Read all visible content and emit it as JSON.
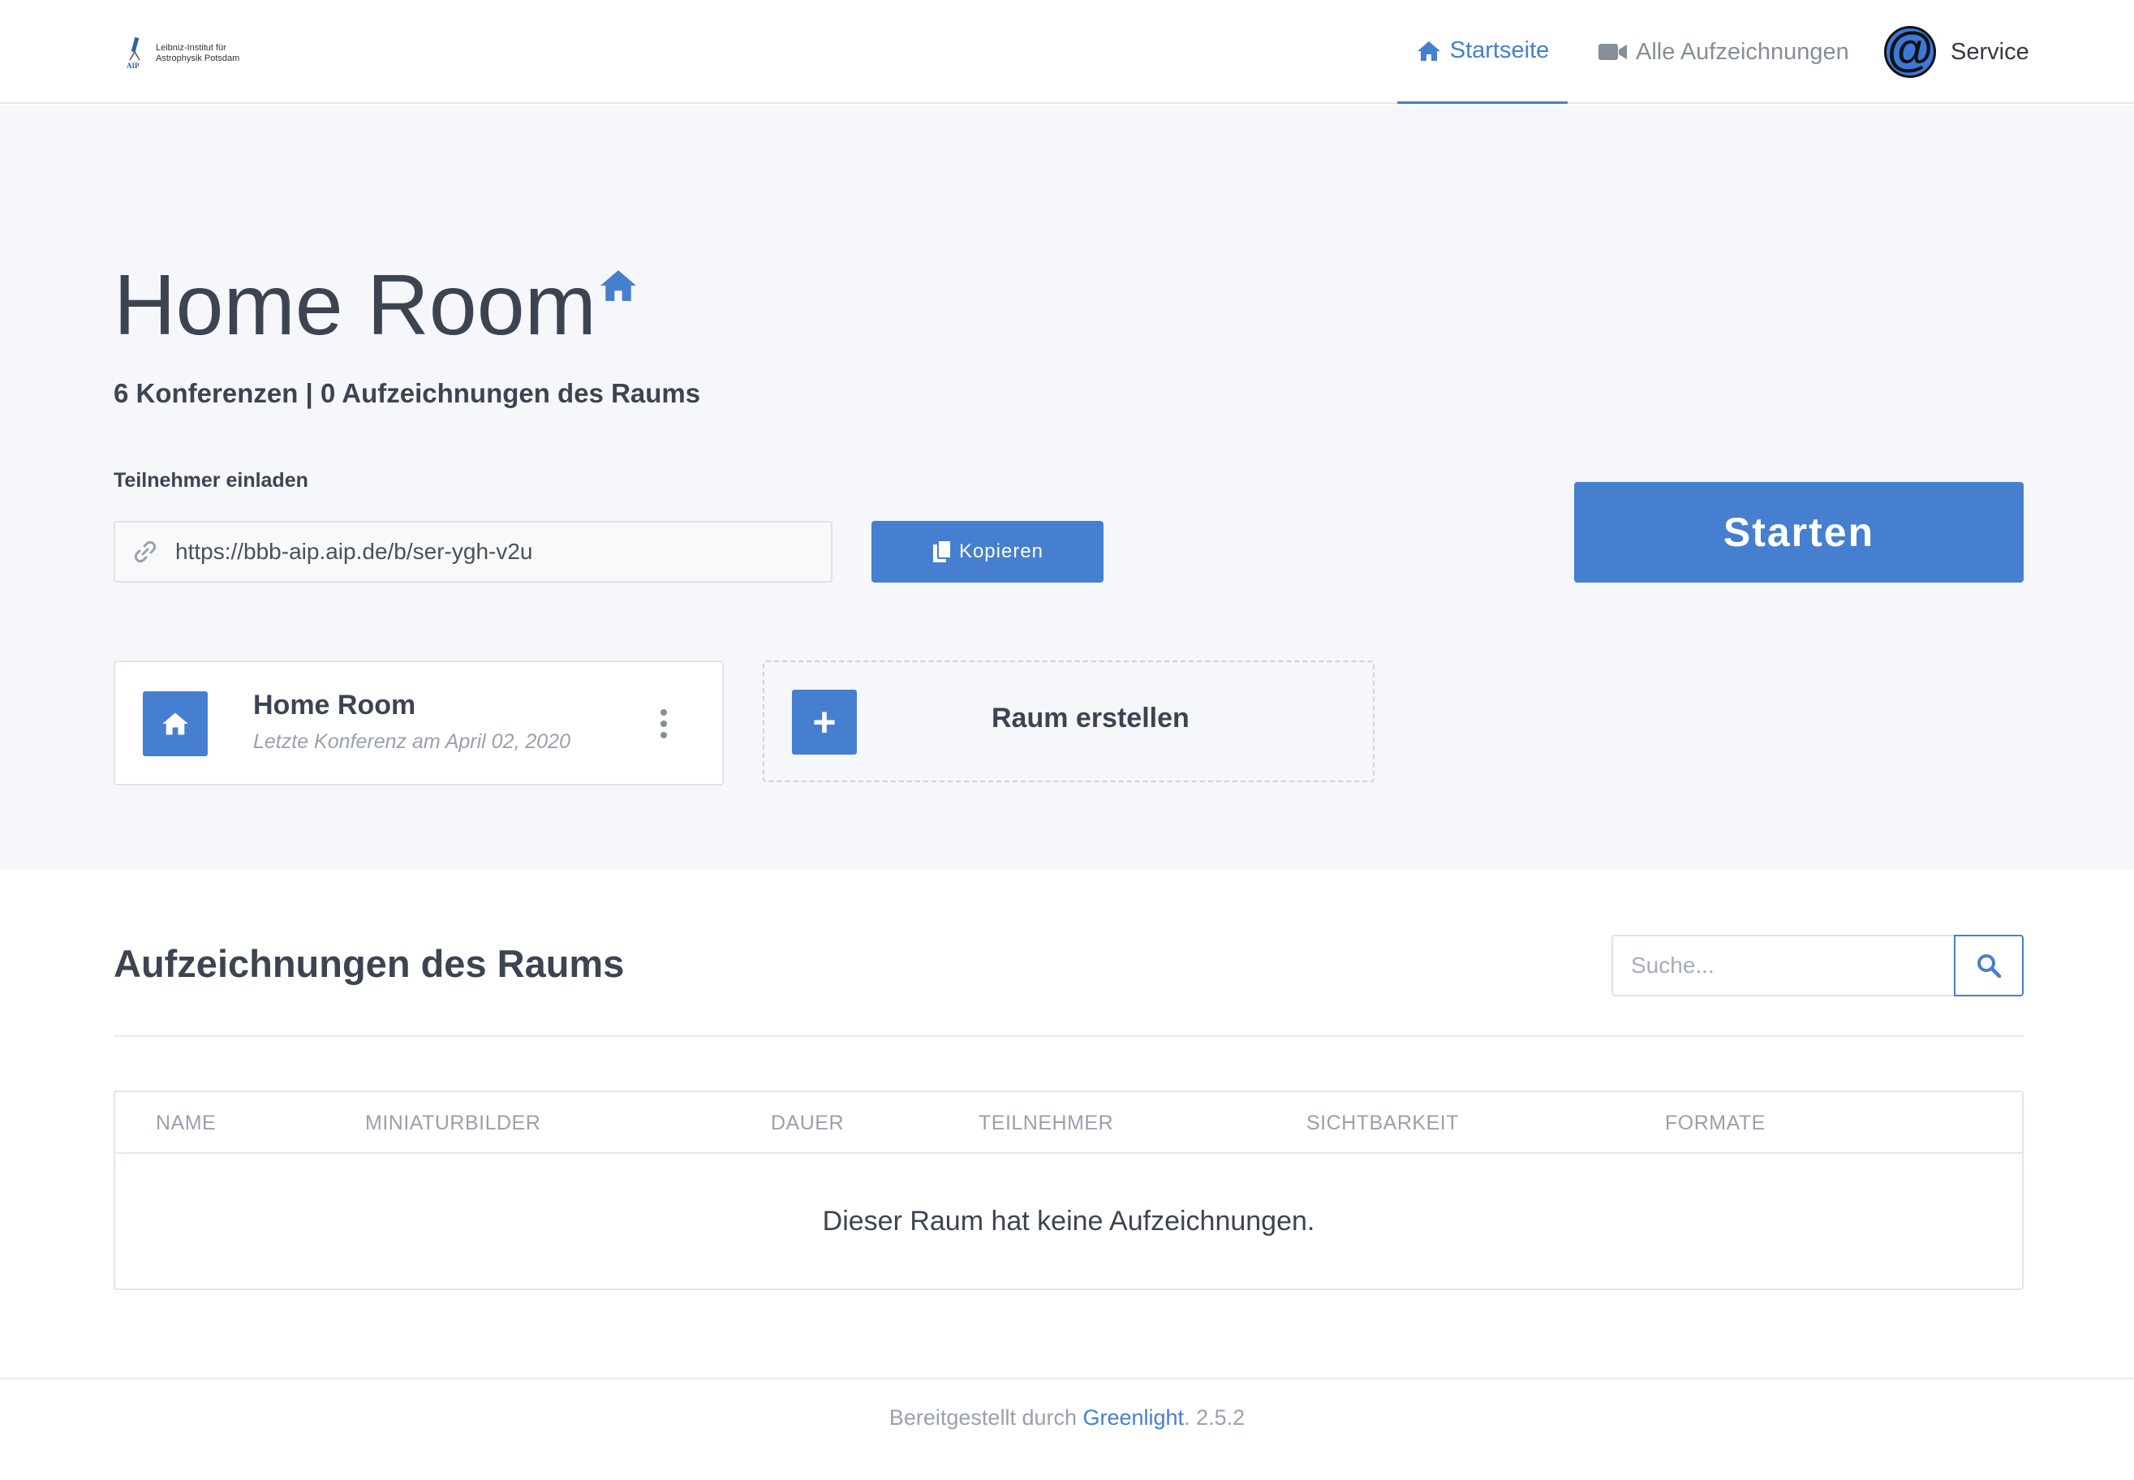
{
  "brand": {
    "logo_abbr": "AIP",
    "line1": "Leibniz-Institut für",
    "line2": "Astrophysik Potsdam"
  },
  "nav": {
    "home": {
      "label": "Startseite",
      "icon": "home-icon"
    },
    "recordings": {
      "label": "Alle Aufzeichnungen",
      "icon": "video-camera-icon"
    },
    "service": {
      "label": "Service",
      "avatar_glyph": "@"
    }
  },
  "hero": {
    "title": "Home Room",
    "stats": "6 Konferenzen | 0 Aufzeichnungen des Raums",
    "invite_label": "Teilnehmer einladen",
    "invite_url": "https://bbb-aip.aip.de/b/ser-ygh-v2u",
    "copy_label": "Kopieren",
    "start_label": "Starten"
  },
  "room_card": {
    "name": "Home Room",
    "last_session": "Letzte Konferenz am April 02, 2020"
  },
  "create_card": {
    "icon_glyph": "+",
    "label": "Raum erstellen"
  },
  "recordings": {
    "title": "Aufzeichnungen des Raums",
    "search_placeholder": "Suche...",
    "columns": [
      "NAME",
      "MINIATURBILDER",
      "DAUER",
      "TEILNEHMER",
      "SICHTBARKEIT",
      "FORMATE"
    ],
    "empty_message": "Dieser Raum hat keine Aufzeichnungen."
  },
  "footer": {
    "prefix": "Bereitgestellt durch ",
    "link": "Greenlight",
    "suffix": ". 2.5.2"
  },
  "colors": {
    "accent": "#467fcf",
    "hero_bg": "#f5f7fb",
    "text_dark": "#3d4451",
    "text_muted": "#9aa0ac"
  }
}
